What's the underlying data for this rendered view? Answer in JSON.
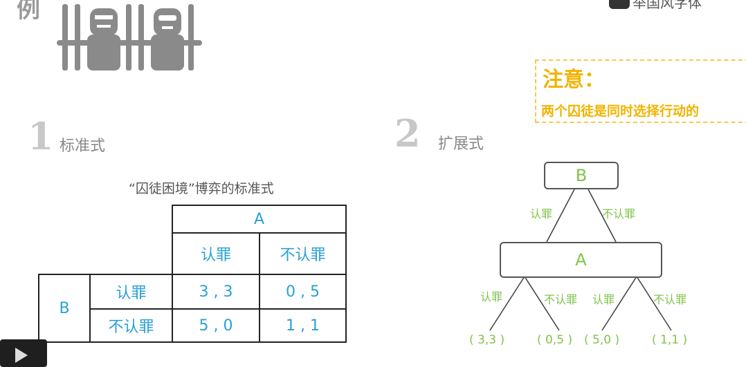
{
  "top_title_fragment": "例",
  "top_right_fragment": "举国风字体",
  "note": {
    "title": "注意：",
    "text": "两个囚徒是同时选择行动的"
  },
  "sections": [
    {
      "number": "1",
      "label": "标准式"
    },
    {
      "number": "2",
      "label": "扩展式"
    }
  ],
  "matrix": {
    "caption": "“囚徒困境”博弈的标准式",
    "col_player": "A",
    "row_player": "B",
    "col_strategies": [
      "认罪",
      "不认罪"
    ],
    "row_strategies": [
      "认罪",
      "不认罪"
    ],
    "payoffs": [
      [
        "3 , 3",
        "0 , 5"
      ],
      [
        "5 , 0",
        "1 , 1"
      ]
    ]
  },
  "tree": {
    "root": "B",
    "child": "A",
    "root_edges": [
      "认罪",
      "不认罪"
    ],
    "child_edges": [
      "认罪",
      "不认罪",
      "认罪",
      "不认罪"
    ],
    "payoffs": [
      "( 3,3 )",
      "( 0,5 )",
      "( 5,0 )",
      "( 1,1 )"
    ]
  },
  "colors": {
    "matrix_text": "#29a0d8",
    "tree_text": "#7fc34a",
    "note": "#f0b400"
  },
  "icons": [
    "prison-bars-icon",
    "play-icon"
  ]
}
